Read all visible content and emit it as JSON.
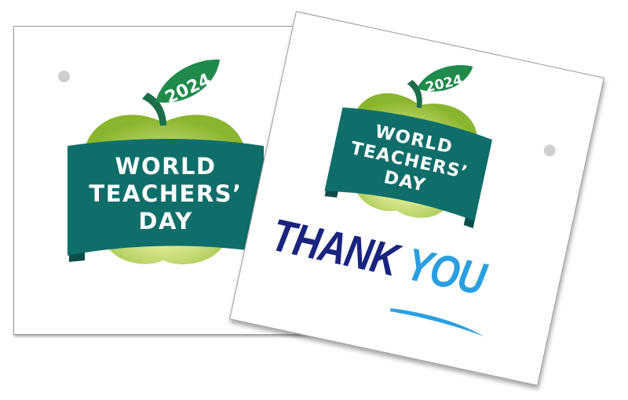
{
  "cards": [
    {
      "year": "2024",
      "banner_lines": [
        "WORLD",
        "TEACHERS’",
        "DAY"
      ]
    },
    {
      "year": "2024",
      "banner_lines": [
        "WORLD",
        "TEACHERS’",
        "DAY"
      ],
      "thank_word": "THANK",
      "you_word": "YOU"
    }
  ],
  "colors": {
    "apple_light": "#e6f0a0",
    "apple_dark": "#8ab52e",
    "banner": "#0f6e6a",
    "banner_shadow": "#0a4c49",
    "leaf": "#1f8a4c",
    "stem": "#1d6d4a",
    "thank": "#1a237e",
    "you": "#2a9fe0",
    "hole": "#cfcfcf"
  },
  "icons": [
    "apple-icon",
    "leaf-icon",
    "card-hole-icon",
    "swoosh-underline-icon"
  ]
}
